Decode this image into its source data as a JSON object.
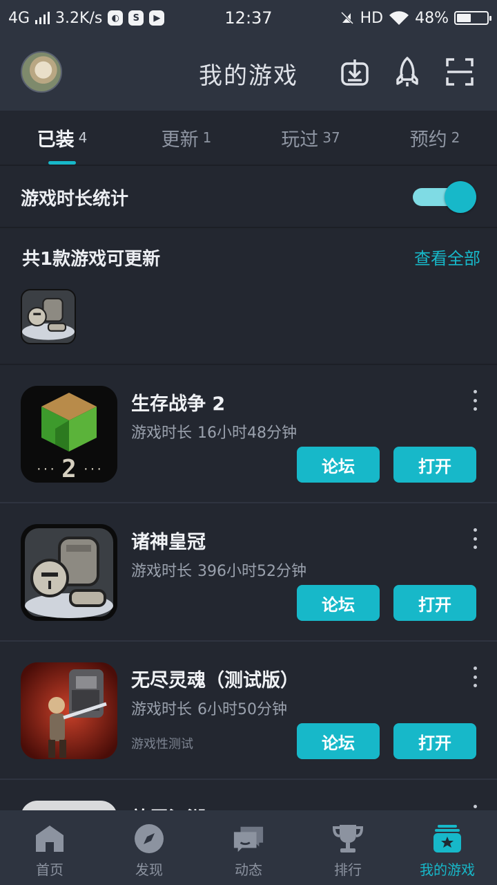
{
  "status_bar": {
    "network": "4G",
    "speed": "3.2K/s",
    "time": "12:37",
    "hd": "HD",
    "battery": "48%",
    "battery_level": 0.48
  },
  "header": {
    "title": "我的游戏",
    "icons": [
      "download-icon",
      "rocket-icon",
      "scan-icon"
    ]
  },
  "tabs": [
    {
      "label": "已装",
      "count": "4",
      "active": true
    },
    {
      "label": "更新",
      "count": "1",
      "active": false
    },
    {
      "label": "玩过",
      "count": "37",
      "active": false
    },
    {
      "label": "预约",
      "count": "2",
      "active": false
    }
  ],
  "stats": {
    "label": "游戏时长统计",
    "enabled": true
  },
  "updates": {
    "title": "共1款游戏可更新",
    "view_all": "查看全部"
  },
  "games": [
    {
      "name": "生存战争 2",
      "time_label": "游戏时长",
      "time_value": "16小时48分钟",
      "tag": "",
      "forum": "论坛",
      "open": "打开"
    },
    {
      "name": "诸神皇冠",
      "time_label": "游戏时长",
      "time_value": "396小时52分钟",
      "tag": "",
      "forum": "论坛",
      "open": "打开"
    },
    {
      "name": "无尽灵魂（测试版）",
      "time_label": "游戏时长",
      "time_value": "6小时50分钟",
      "tag": "游戏性测试",
      "forum": "论坛",
      "open": "打开"
    },
    {
      "name": "放置江湖",
      "time_label": "",
      "time_value": "",
      "tag": "",
      "forum": "",
      "open": ""
    }
  ],
  "bottom_nav": [
    {
      "label": "首页",
      "icon": "home-icon",
      "active": false
    },
    {
      "label": "发现",
      "icon": "compass-icon",
      "active": false
    },
    {
      "label": "动态",
      "icon": "chat-icon",
      "active": false
    },
    {
      "label": "排行",
      "icon": "trophy-icon",
      "active": false
    },
    {
      "label": "我的游戏",
      "icon": "my-games-icon",
      "active": true
    }
  ],
  "colors": {
    "accent": "#17b8c9",
    "background": "#232730",
    "bar": "#2e3440"
  }
}
